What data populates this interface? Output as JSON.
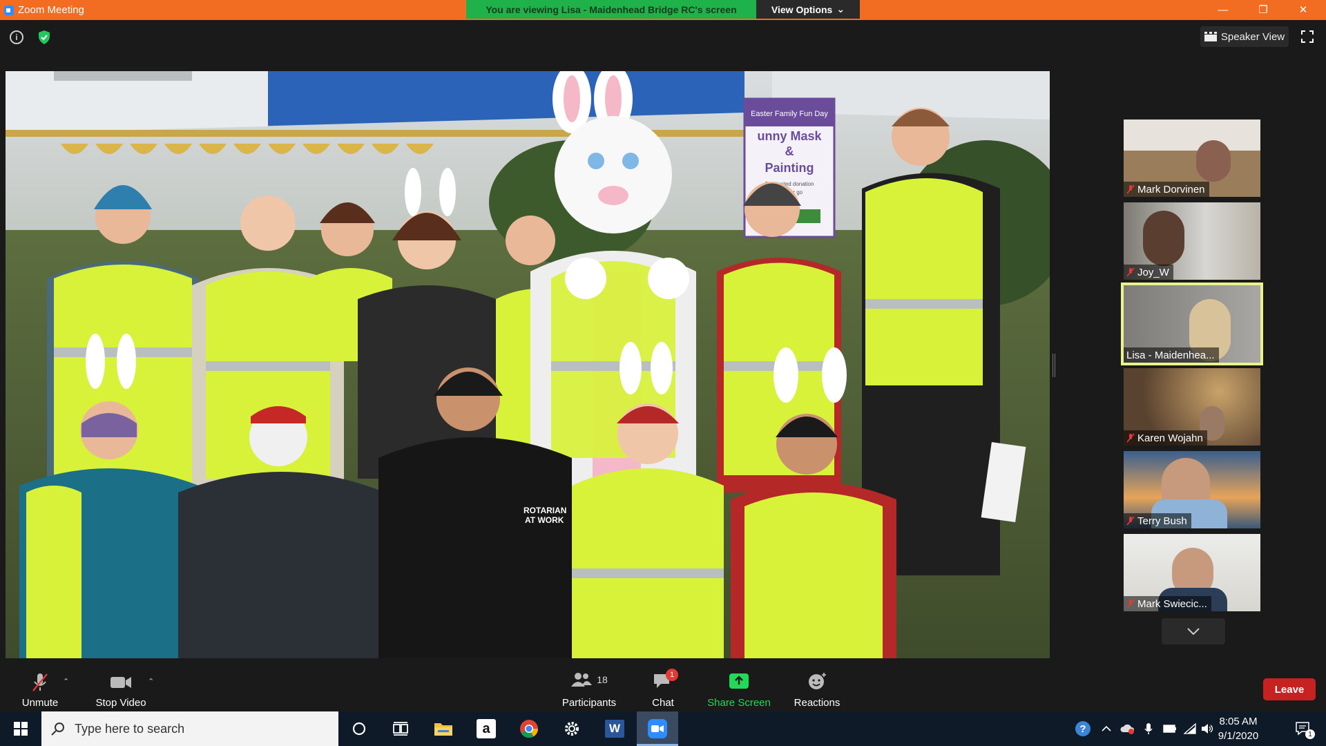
{
  "window": {
    "title": "Zoom Meeting",
    "viewing_banner": "You are viewing Lisa - Maidenhead Bridge RC's screen",
    "view_options": "View Options"
  },
  "topbar": {
    "speaker_view": "Speaker View"
  },
  "shared_photo": {
    "sign_line1": "Easter Family Fun Day",
    "sign_line2": "unny Mask",
    "sign_line3": "&",
    "sign_line4": "Painting",
    "sign_line5": "Suggested donation",
    "sign_line6": "50p per go",
    "shirt_text1": "ROTARIAN",
    "shirt_text2": "AT WORK"
  },
  "participants_gallery": [
    {
      "name": "Mark Dorvinen",
      "muted": true
    },
    {
      "name": "Joy_W",
      "muted": true
    },
    {
      "name": "Lisa - Maidenhea...",
      "muted": false,
      "active": true
    },
    {
      "name": "Karen Wojahn",
      "muted": true
    },
    {
      "name": "Terry Bush",
      "muted": true
    },
    {
      "name": "Mark Swiecic...",
      "muted": true
    }
  ],
  "toolbar": {
    "unmute": "Unmute",
    "stop_video": "Stop Video",
    "participants": "Participants",
    "participants_count": "18",
    "chat": "Chat",
    "chat_badge": "1",
    "share_screen": "Share Screen",
    "reactions": "Reactions",
    "leave": "Leave"
  },
  "taskbar": {
    "search_placeholder": "Type here to search",
    "time": "8:05 AM",
    "date": "9/1/2020",
    "notification_count": "1"
  },
  "colors": {
    "zoom_orange": "#f26d21",
    "banner_green": "#20b24a",
    "share_green": "#23d959",
    "leave_red": "#c62222",
    "active_tile": "#e9f28b"
  }
}
